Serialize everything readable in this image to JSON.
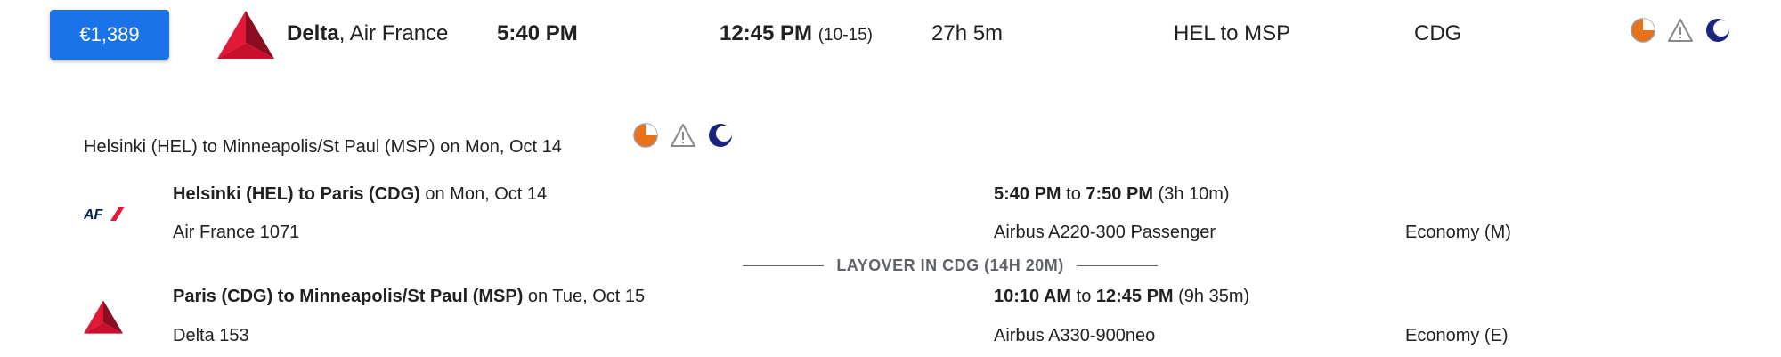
{
  "summary": {
    "price": "€1,389",
    "airline_primary": "Delta",
    "airline_rest": ", Air France",
    "depart_time": "5:40 PM",
    "arrive_time": "12:45 PM",
    "arrive_date": "(10-15)",
    "duration": "27h 5m",
    "route": "HEL to MSP",
    "stops": "CDG",
    "icons": [
      "partial-time-icon",
      "warning-icon",
      "night-flight-icon"
    ]
  },
  "itinerary": {
    "title": "Helsinki (HEL) to Minneapolis/St Paul (MSP) on Mon, Oct 14",
    "icons": [
      "partial-time-icon",
      "warning-icon",
      "night-flight-icon"
    ]
  },
  "segments": [
    {
      "airline_icon": "air-france-logo",
      "route": "Helsinki (HEL) to Paris (CDG)",
      "date": " on Mon, Oct 14",
      "flight": "Air France 1071",
      "dep": "5:40 PM",
      "to": " to ",
      "arr": "7:50 PM",
      "dur": " (3h 10m)",
      "aircraft": "Airbus A220-300 Passenger",
      "cabin": "Economy (M)"
    },
    {
      "airline_icon": "delta-logo",
      "route": "Paris (CDG) to Minneapolis/St Paul (MSP)",
      "date": " on Tue, Oct 15",
      "flight": "Delta 153",
      "dep": "10:10 AM",
      "to": " to ",
      "arr": "12:45 PM",
      "dur": " (9h 35m)",
      "aircraft": "Airbus A330-900neo",
      "cabin": "Economy (E)"
    }
  ],
  "layover": "LAYOVER IN CDG (14H 20M)",
  "colors": {
    "price_button": "#1a73e8",
    "delta_red": "#c8102e",
    "air_france_blue": "#002157",
    "orange": "#e8711a",
    "navy": "#1a237e"
  }
}
